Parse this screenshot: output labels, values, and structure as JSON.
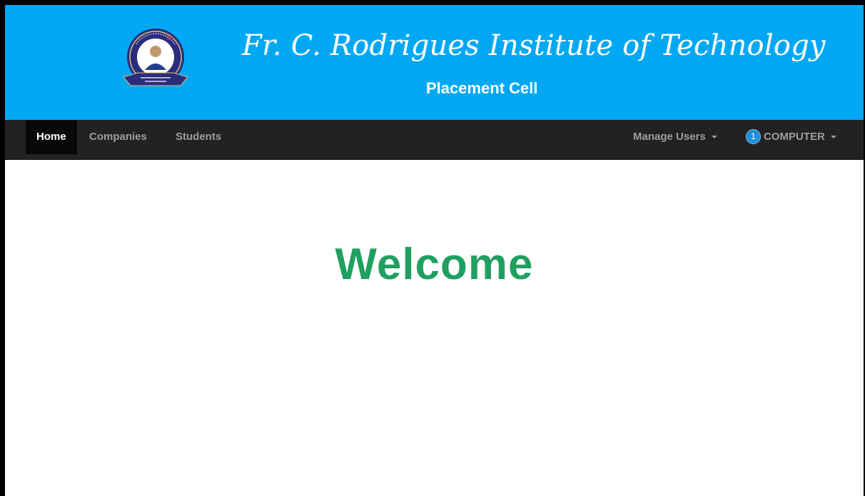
{
  "header": {
    "title": "Fr. C. Rodrigues Institute of Technology",
    "subtitle": "Placement Cell",
    "logo_icon": "college-seal-logo"
  },
  "navbar": {
    "items": [
      {
        "label": "Home",
        "active": true
      },
      {
        "label": "Companies",
        "active": false
      },
      {
        "label": "Students",
        "active": false
      }
    ],
    "manage_users": "Manage Users",
    "user_badge": "1",
    "user_label": "COMPUTER"
  },
  "main": {
    "welcome": "Welcome"
  },
  "colors": {
    "header_bg": "#00a8f4",
    "navbar_bg": "#222222",
    "welcome_text": "#20a060"
  }
}
